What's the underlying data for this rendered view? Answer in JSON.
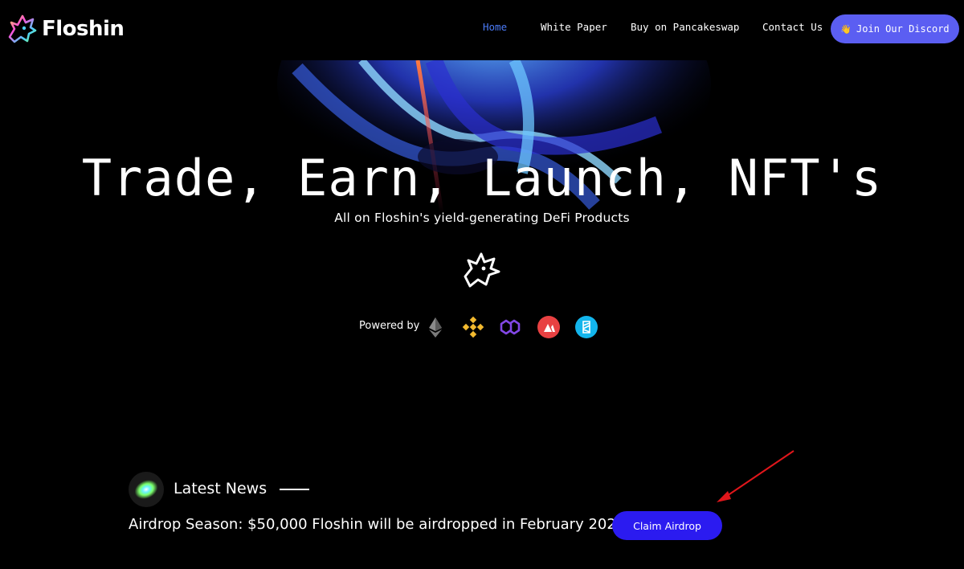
{
  "brand": {
    "name": "Floshin"
  },
  "nav": {
    "items": [
      {
        "label": "Home",
        "active": true
      },
      {
        "label": "White Paper",
        "active": false
      },
      {
        "label": "Buy on Pancakeswap",
        "active": false
      },
      {
        "label": "Contact Us",
        "active": false
      }
    ],
    "discord_label": "Join Our Discord",
    "discord_icon": "waving-hand-icon"
  },
  "hero": {
    "title": "Trade, Earn, Launch, NFT's",
    "subtitle": "All on Floshin's yield-generating DeFi Products"
  },
  "powered": {
    "label": "Powered by",
    "chains": [
      "ethereum-icon",
      "binance-icon",
      "polygon-icon",
      "avalanche-icon",
      "fantom-icon"
    ]
  },
  "news": {
    "title": "Latest News",
    "text": "Airdrop Season: $50,000 Floshin will be airdropped in February 2022.",
    "button_label": "Claim Airdrop"
  },
  "colors": {
    "nav_active": "#4b7bf7",
    "discord_button": "#5b5ef2",
    "claim_button": "#2b1bf0",
    "annotation_arrow": "#e0161b"
  }
}
